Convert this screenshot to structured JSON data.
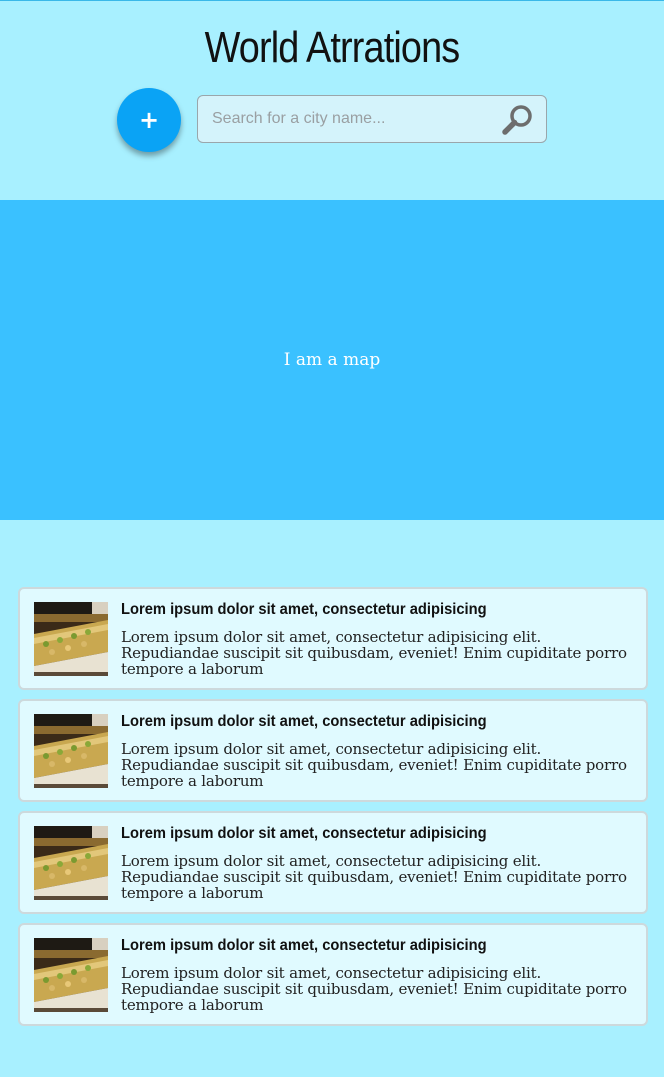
{
  "header": {
    "title": "World Atrrations",
    "add_button_label": "+",
    "add_icon": "plus-icon"
  },
  "search": {
    "placeholder": "Search for a city name...",
    "value": "",
    "icon": "search-icon"
  },
  "map": {
    "label": "I am a map"
  },
  "attractions": [
    {
      "title": "Lorem ipsum dolor sit amet, consectetur adipisicing",
      "description": "Lorem ipsum dolor sit amet, consectetur adipisicing elit. Repudiandae suscipit sit quibusdam, eveniet! Enim cupiditate porro tempore a laborum"
    },
    {
      "title": "Lorem ipsum dolor sit amet, consectetur adipisicing",
      "description": "Lorem ipsum dolor sit amet, consectetur adipisicing elit. Repudiandae suscipit sit quibusdam, eveniet! Enim cupiditate porro tempore a laborum"
    },
    {
      "title": "Lorem ipsum dolor sit amet, consectetur adipisicing",
      "description": "Lorem ipsum dolor sit amet, consectetur adipisicing elit. Repudiandae suscipit sit quibusdam, eveniet! Enim cupiditate porro tempore a laborum"
    },
    {
      "title": "Lorem ipsum dolor sit amet, consectetur adipisicing",
      "description": "Lorem ipsum dolor sit amet, consectetur adipisicing elit. Repudiandae suscipit sit quibusdam, eveniet! Enim cupiditate porro tempore a laborum"
    }
  ],
  "colors": {
    "page_background": "#a8f0ff",
    "map_background": "#3ac1ff",
    "accent": "#0aa3f5",
    "card_background": "#e0faff"
  }
}
